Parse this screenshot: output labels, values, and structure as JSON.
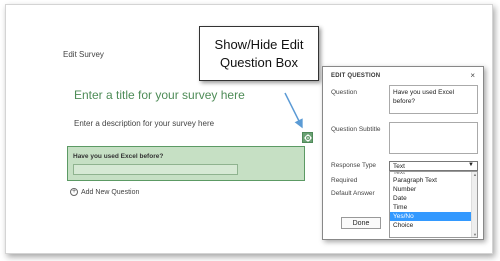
{
  "header": {
    "title": "Edit Survey"
  },
  "survey": {
    "title_placeholder": "Enter a title for your survey here",
    "description_placeholder": "Enter a description for your survey here",
    "question_text": "Have you used Excel before?",
    "add_question_label": "Add New Question"
  },
  "callout": {
    "line1": "Show/Hide Edit",
    "line2": "Question Box"
  },
  "edit_panel": {
    "title": "EDIT QUESTION",
    "close_label": "×",
    "question_label": "Question",
    "question_value": "Have you used Excel before?",
    "subtitle_label": "Question Subtitle",
    "subtitle_value": "",
    "response_type_label": "Response Type",
    "response_type_value": "Text",
    "required_label": "Required",
    "default_answer_label": "Default Answer",
    "done_label": "Done",
    "options": [
      "Text",
      "Paragraph Text",
      "Number",
      "Date",
      "Time",
      "Yes/No",
      "Choice"
    ],
    "highlighted_option": "Yes/No"
  },
  "colors": {
    "accent_green": "#4e8c57",
    "question_bg": "#c6e0c4",
    "highlight_blue": "#3399ff"
  },
  "icons": {
    "settings": "gear-icon",
    "add": "plus-circle-icon",
    "close": "close-icon",
    "dropdown": "chevron-down-icon"
  }
}
